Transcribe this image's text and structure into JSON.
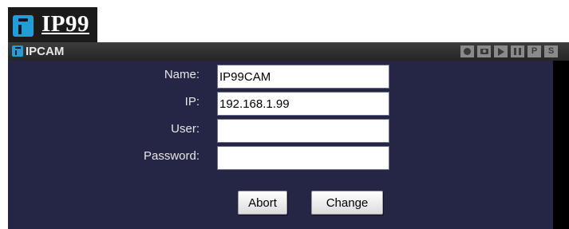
{
  "header": {
    "logo_text": "IP99"
  },
  "titlebar": {
    "title": "IPCAM",
    "tools": [
      {
        "icon": "record-icon",
        "label": ""
      },
      {
        "icon": "camera-icon",
        "label": ""
      },
      {
        "icon": "play-icon",
        "label": ""
      },
      {
        "icon": "pause-icon",
        "label": ""
      },
      {
        "icon": "p-icon",
        "label": "P"
      },
      {
        "icon": "s-icon",
        "label": "S"
      }
    ]
  },
  "form": {
    "name_label": "Name:",
    "name_value": "IP99CAM",
    "ip_label": "IP:",
    "ip_value": "192.168.1.99",
    "user_label": "User:",
    "user_value": "",
    "password_label": "Password:",
    "password_value": ""
  },
  "buttons": {
    "abort_label": "Abort",
    "change_label": "Change"
  },
  "colors": {
    "content_bg": "#252545",
    "titlebar_bg": "#333333",
    "logo_accent": "#1f9fd6",
    "frame_bg": "#000000"
  }
}
